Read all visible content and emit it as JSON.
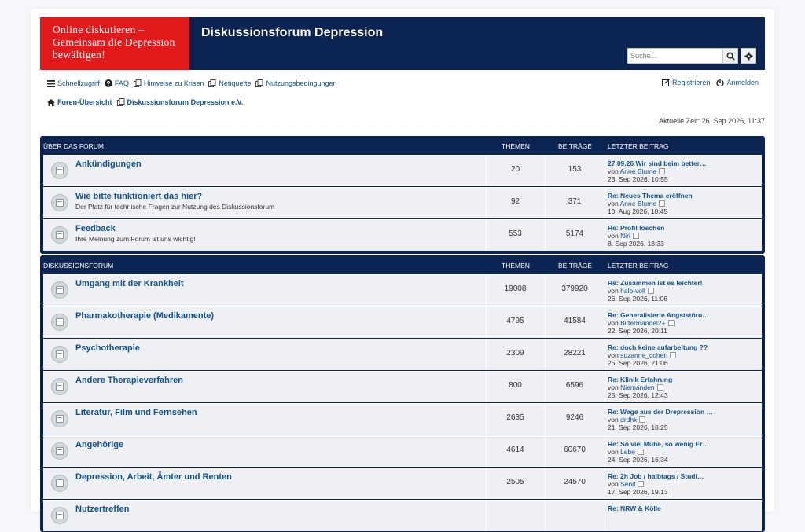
{
  "header": {
    "logo_text": "Online diskutieren – Gemeinsam die Depression bewältigen!",
    "title": "Diskussionsforum Depression",
    "search_placeholder": "Suche…"
  },
  "nav": {
    "quick": "Schnellzugriff",
    "faq": "FAQ",
    "crisis": "Hinweise zu Krisen",
    "netiquette": "Netiquette",
    "terms": "Nutzungsbedingungen",
    "register": "Registrieren",
    "login": "Anmelden"
  },
  "breadcrumb": {
    "home": "Foren-Übersicht",
    "section": "Diskussionsforum Depression e.V."
  },
  "current_time": "Aktuelle Zeit: 26. Sep 2026, 11:37",
  "categories": [
    {
      "name": "ÜBER DAS FORUM",
      "col_topics": "THEMEN",
      "col_posts": "BEITRÄGE",
      "col_last": "LETZTER BEITRAG",
      "forums": [
        {
          "title": "Ankündigungen",
          "desc": "",
          "topics": "20",
          "posts": "153",
          "last_title": "27.09.26 Wir sind beim better…",
          "last_by": "von",
          "last_user": "Anne Blume",
          "last_date": "23. Sep 2026, 10:55"
        },
        {
          "title": "Wie bitte funktioniert das hier?",
          "desc": "Der Platz für technische Fragen zur Nutzung des Diskussionsforum",
          "topics": "92",
          "posts": "371",
          "last_title": "Re: Neues Thema eröffnen",
          "last_by": "von",
          "last_user": "Anne Blume",
          "last_date": "10. Aug 2026, 10:45"
        },
        {
          "title": "Feedback",
          "desc": "Ihre Meinung zum Forum ist uns wichtig!",
          "topics": "553",
          "posts": "5174",
          "last_title": "Re: Profil löschen",
          "last_by": "von",
          "last_user": "Niri",
          "last_date": "8. Sep 2026, 18:33"
        }
      ]
    },
    {
      "name": "DISKUSSIONSFORUM",
      "col_topics": "THEMEN",
      "col_posts": "BEITRÄGE",
      "col_last": "LETZTER BEITRAG",
      "forums": [
        {
          "title": "Umgang mit der Krankheit",
          "desc": "",
          "topics": "19008",
          "posts": "379920",
          "last_title": "Re: Zusammen ist es leichter!",
          "last_by": "von",
          "last_user": "halb-voll",
          "last_date": "26. Sep 2026, 11:06"
        },
        {
          "title": "Pharmakotherapie (Medikamente)",
          "desc": "",
          "topics": "4795",
          "posts": "41584",
          "last_title": "Re: Generalisierte Angststöru…",
          "last_by": "von",
          "last_user": "Bittermandel2+",
          "last_date": "22. Sep 2026, 20:11"
        },
        {
          "title": "Psychotherapie",
          "desc": "",
          "topics": "2309",
          "posts": "28221",
          "last_title": "Re: doch keine aufarbeitung ??",
          "last_by": "von",
          "last_user": "suzanne_cohen",
          "last_date": "25. Sep 2026, 21:06"
        },
        {
          "title": "Andere Therapieverfahren",
          "desc": "",
          "topics": "800",
          "posts": "6596",
          "last_title": "Re: Klinik Erfahrung",
          "last_by": "von",
          "last_user": "Niemanden",
          "last_date": "25. Sep 2026, 12:43"
        },
        {
          "title": "Literatur, Film und Fernsehen",
          "desc": "",
          "topics": "2635",
          "posts": "9246",
          "last_title": "Re: Wege aus der Drepression …",
          "last_by": "von",
          "last_user": "drdhk",
          "last_date": "21. Sep 2026, 18:25"
        },
        {
          "title": "Angehörige",
          "desc": "",
          "topics": "4614",
          "posts": "60670",
          "last_title": "Re: So viel Mühe, so wenig Er…",
          "last_by": "von",
          "last_user": "Lebe",
          "last_date": "24. Sep 2026, 16:34"
        },
        {
          "title": "Depression, Arbeit, Ämter und Renten",
          "desc": "",
          "topics": "2505",
          "posts": "24570",
          "last_title": "Re: 2h Job / halbtags / Studi…",
          "last_by": "von",
          "last_user": "Senif",
          "last_date": "17. Sep 2026, 19:13"
        },
        {
          "title": "Nutzertreffen",
          "desc": "",
          "topics": "",
          "posts": "",
          "last_title": "Re: NRW & Kölle",
          "last_by": "",
          "last_user": "",
          "last_date": ""
        }
      ]
    }
  ]
}
